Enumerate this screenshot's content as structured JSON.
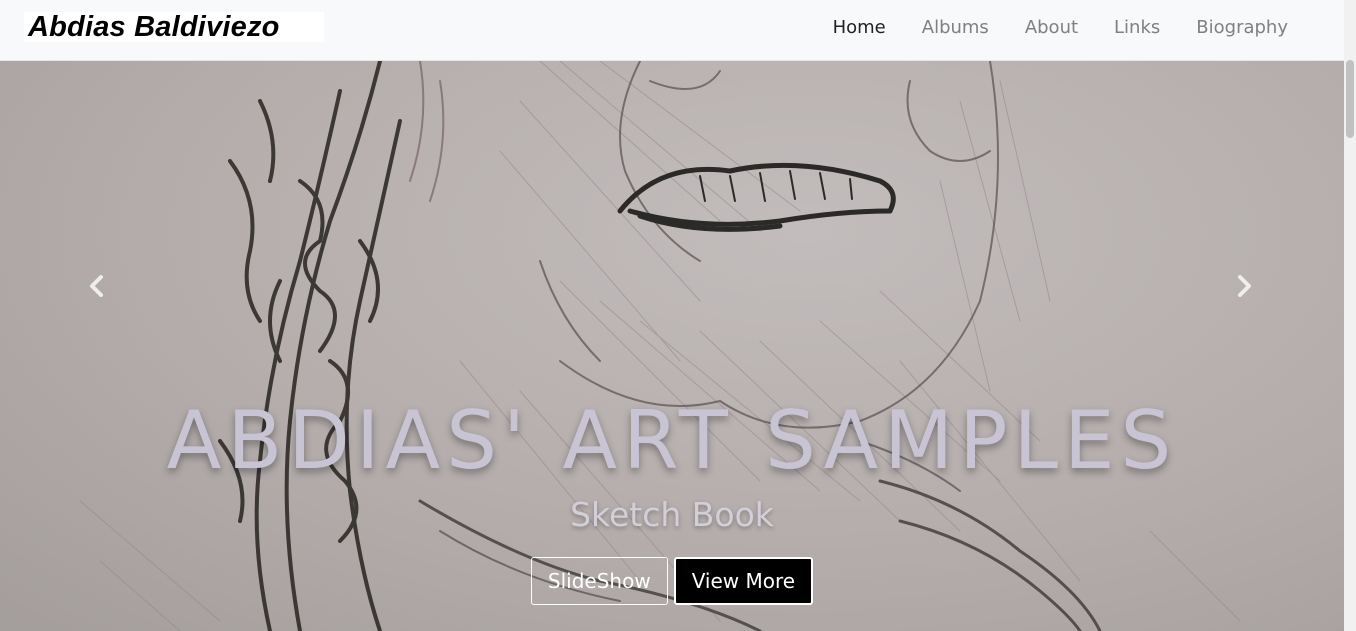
{
  "brand": {
    "name": "Abdias Baldiviezo"
  },
  "nav": {
    "items": [
      {
        "label": "Home",
        "active": true
      },
      {
        "label": "Albums",
        "active": false
      },
      {
        "label": "About",
        "active": false
      },
      {
        "label": "Links",
        "active": false
      },
      {
        "label": "Biography",
        "active": false
      }
    ]
  },
  "carousel": {
    "title": "ABDIAS' ART SAMPLES",
    "subtitle": "Sketch Book",
    "slideshow_label": "SlideShow",
    "view_more_label": "View More",
    "prev_icon": "chevron-left-icon",
    "next_icon": "chevron-right-icon"
  },
  "colors": {
    "navbar_bg": "#f8f9fa",
    "active_link": "#222222",
    "link": "#808080",
    "primary_button": "#000000"
  }
}
